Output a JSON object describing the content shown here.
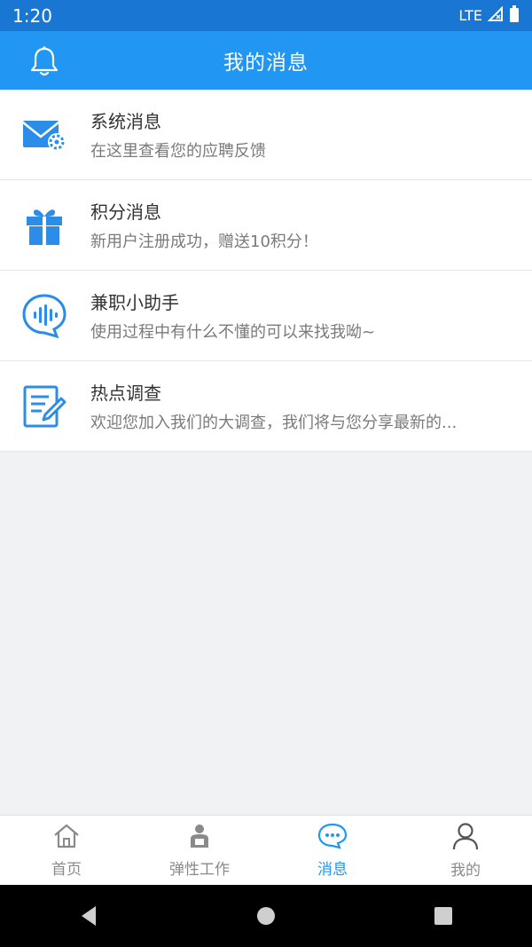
{
  "status": {
    "time": "1:20",
    "network": "LTE"
  },
  "header": {
    "title": "我的消息"
  },
  "messages": [
    {
      "title": "系统消息",
      "subtitle": "在这里查看您的应聘反馈",
      "icon": "mail-gear-icon"
    },
    {
      "title": "积分消息",
      "subtitle": "新用户注册成功，赠送10积分！",
      "icon": "gift-icon"
    },
    {
      "title": "兼职小助手",
      "subtitle": "使用过程中有什么不懂的可以来找我呦~",
      "icon": "voice-chat-icon"
    },
    {
      "title": "热点调查",
      "subtitle": "欢迎您加入我们的大调查，我们将与您分享最新的...",
      "icon": "survey-edit-icon"
    }
  ],
  "tabs": [
    {
      "label": "首页",
      "icon": "home-icon",
      "active": false
    },
    {
      "label": "弹性工作",
      "icon": "worker-icon",
      "active": false
    },
    {
      "label": "消息",
      "icon": "chat-icon",
      "active": true
    },
    {
      "label": "我的",
      "icon": "person-icon",
      "active": false
    }
  ],
  "colors": {
    "primary": "#2196f3",
    "status_bar": "#1976d2",
    "inactive": "#8a8a8a"
  }
}
